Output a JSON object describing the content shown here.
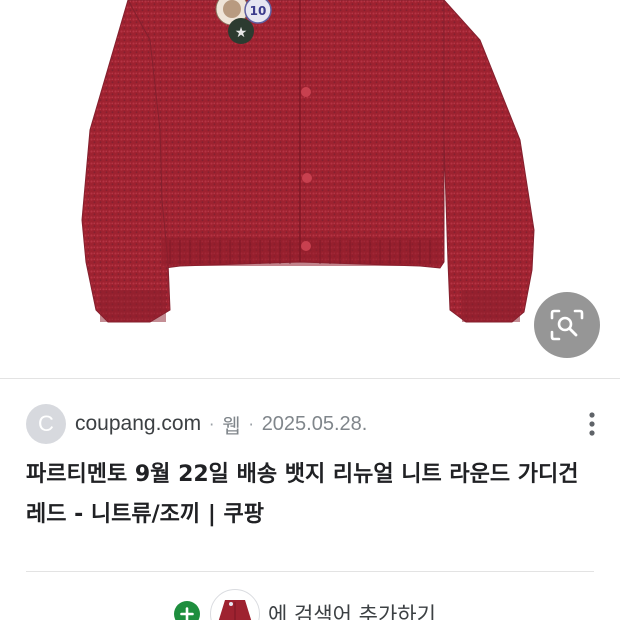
{
  "result": {
    "site_initial": "C",
    "site_name": "coupang.com",
    "separator": "·",
    "type": "웹",
    "date": "2025.05.28.",
    "title": "파르티멘토 9월 22일 배송 뱃지 리뉴얼 니트 라운드 가디건 레드 - 니트류/조끼 | 쿠팡"
  },
  "image": {
    "subject": "red knit cardigan with badges",
    "badge_number": "10",
    "colors": {
      "knit": "#9e2230",
      "knit_dark": "#7e1726",
      "button": "#c8404f"
    }
  },
  "icons": {
    "lens": "image-search-icon",
    "more": "more-vert-icon",
    "plus": "plus-icon"
  },
  "add_to_search": {
    "label": "에 검색어 추가하기"
  },
  "colors": {
    "accent_green": "#1e8e3e",
    "text_primary": "#202124",
    "text_secondary": "#80868b"
  }
}
